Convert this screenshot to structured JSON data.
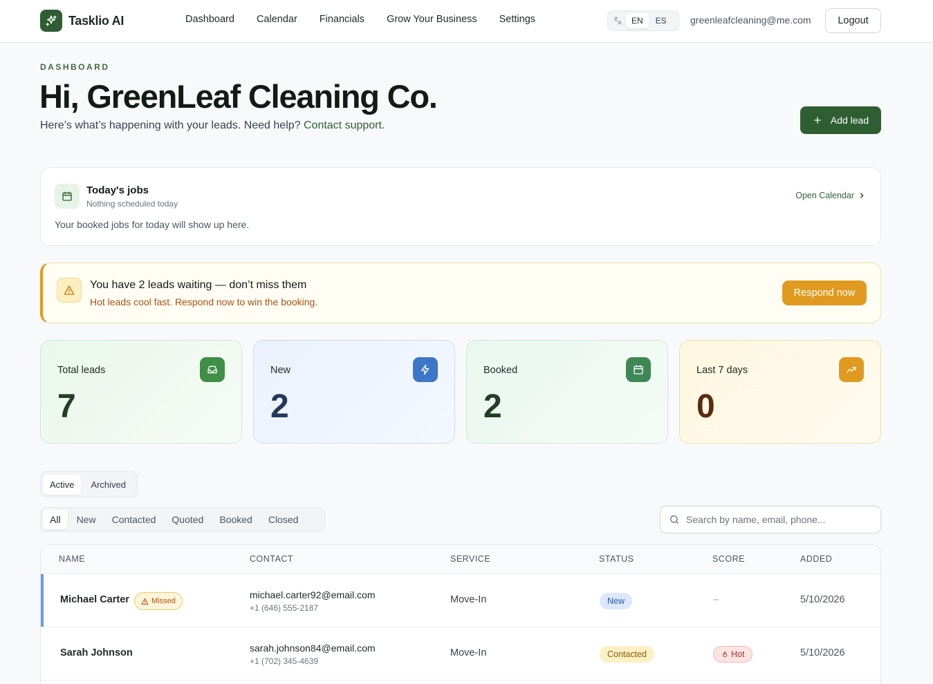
{
  "header": {
    "logo_text": "Tasklio AI",
    "nav": [
      "Dashboard",
      "Calendar",
      "Financials",
      "Grow Your Business",
      "Settings"
    ],
    "lang": {
      "en": "EN",
      "es": "ES",
      "selected": "EN"
    },
    "user_email": "greenleafcleaning@me.com",
    "logout_label": "Logout"
  },
  "hero": {
    "eyebrow": "DASHBOARD",
    "title": "Hi, GreenLeaf Cleaning Co.",
    "subtitle_prefix": "Here’s what’s happening with your leads. Need help? ",
    "support_link": "Contact support",
    "subtitle_suffix": ".",
    "add_lead_label": "Add lead"
  },
  "jobs": {
    "title": "Today's jobs",
    "subtitle": "Nothing scheduled today",
    "body": "Your booked jobs for today will show up here.",
    "open_calendar": "Open Calendar"
  },
  "alert": {
    "title": "You have 2 leads waiting — don’t miss them",
    "subtitle": "Hot leads cool fast. Respond now to win the booking.",
    "button": "Respond now"
  },
  "stats": [
    {
      "label": "Total leads",
      "value": "7",
      "icon": "inbox-icon"
    },
    {
      "label": "New",
      "value": "2",
      "icon": "bolt-icon"
    },
    {
      "label": "Booked",
      "value": "2",
      "icon": "calendar-icon"
    },
    {
      "label": "Last 7 days",
      "value": "0",
      "icon": "trend-up-icon"
    }
  ],
  "view_tabs": {
    "active": "Active",
    "archived": "Archived",
    "selected": "Active"
  },
  "filters": [
    "All",
    "New",
    "Contacted",
    "Quoted",
    "Booked",
    "Closed"
  ],
  "selected_filter": "All",
  "search": {
    "placeholder": "Search by name, email, phone..."
  },
  "table": {
    "columns": [
      "NAME",
      "CONTACT",
      "SERVICE",
      "STATUS",
      "SCORE",
      "ADDED"
    ],
    "rows": [
      {
        "name": "Michael Carter",
        "badge": "Missed",
        "email": "michael.carter92@email.com",
        "phone": "+1 (646) 555-2187",
        "service": "Move-In",
        "status": "New",
        "score": "–",
        "added": "5/10/2026"
      },
      {
        "name": "Sarah Johnson",
        "badge": "",
        "email": "sarah.johnson84@email.com",
        "phone": "+1 (702) 345-4639",
        "service": "Move-In",
        "status": "Contacted",
        "score": "Hot",
        "added": "5/10/2026"
      }
    ]
  },
  "colors": {
    "brand": "#2f5e33",
    "warning": "#e09a1f",
    "new_blue": "#3d77c9"
  }
}
